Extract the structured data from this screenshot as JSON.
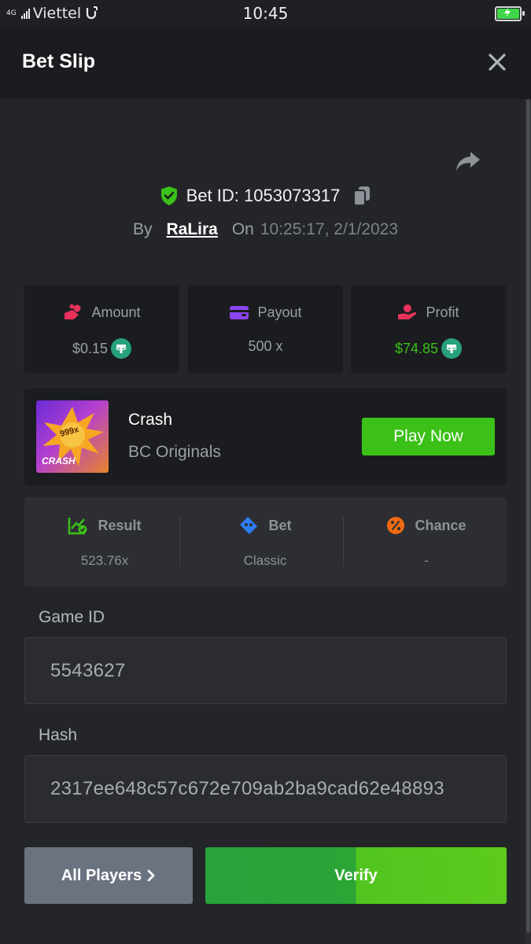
{
  "status_bar": {
    "network": "4G",
    "carrier": "Viettel",
    "time": "10:45"
  },
  "header": {
    "title": "Bet Slip"
  },
  "bet": {
    "id_label": "Bet ID: 1053073317",
    "by_label": "By",
    "username": "RaLira",
    "on_label": "On",
    "datetime": "10:25:17, 2/1/2023"
  },
  "stats": [
    {
      "label": "Amount",
      "value": "$0.15",
      "currency_icon": "tether-icon"
    },
    {
      "label": "Payout",
      "value": "500 x"
    },
    {
      "label": "Profit",
      "value": "$74.85",
      "currency_icon": "tether-icon",
      "value_color": "#3bc117"
    }
  ],
  "game": {
    "thumb_badge": "999x",
    "thumb_title": "CRASH",
    "name": "Crash",
    "provider": "BC Originals",
    "play_label": "Play Now"
  },
  "info": [
    {
      "label": "Result",
      "value": "523.76x",
      "icon": "chart-check-icon",
      "icon_color": "#3bc117"
    },
    {
      "label": "Bet",
      "value": "Classic",
      "icon": "ticket-icon",
      "icon_color": "#2f7cf6"
    },
    {
      "label": "Chance",
      "value": "-",
      "icon": "percent-icon",
      "icon_color": "#f06a12"
    }
  ],
  "fields": {
    "game_id_label": "Game ID",
    "game_id_value": "5543627",
    "hash_label": "Hash",
    "hash_value": "2317ee648c57c672e709ab2ba9cad62e48893"
  },
  "actions": {
    "all_players_label": "All Players",
    "verify_label": "Verify"
  },
  "colors": {
    "accent_green": "#3bc117",
    "background": "#232529",
    "card": "#1b1c1f"
  }
}
